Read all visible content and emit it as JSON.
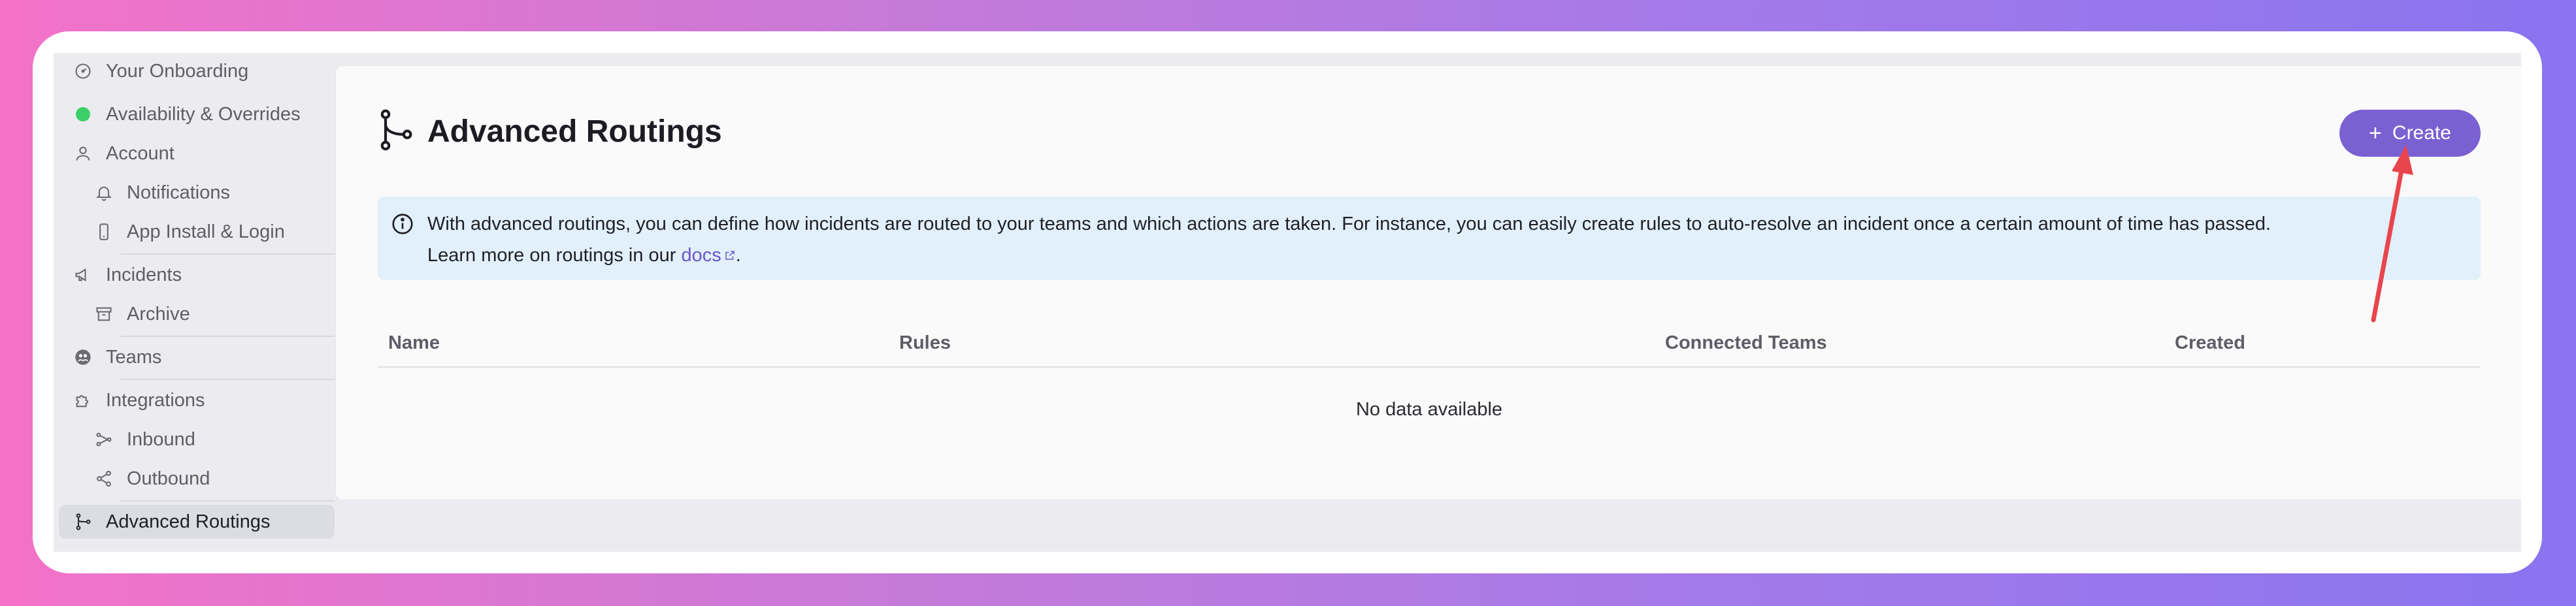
{
  "sidebar": {
    "items": [
      {
        "label": "Your Onboarding",
        "icon": "onboarding-gauge-icon"
      },
      {
        "label": "Availability & Overrides",
        "icon": "status-dot-icon",
        "status_color": "#3ccf6a"
      },
      {
        "label": "Account",
        "icon": "user-icon"
      },
      {
        "label": "Notifications",
        "icon": "bell-icon"
      },
      {
        "label": "App Install & Login",
        "icon": "smartphone-icon"
      },
      {
        "label": "Incidents",
        "icon": "megaphone-icon"
      },
      {
        "label": "Archive",
        "icon": "archive-icon"
      },
      {
        "label": "Teams",
        "icon": "teams-icon"
      },
      {
        "label": "Integrations",
        "icon": "puzzle-icon"
      },
      {
        "label": "Inbound",
        "icon": "inbound-icon"
      },
      {
        "label": "Outbound",
        "icon": "share-icon"
      },
      {
        "label": "Advanced Routings",
        "icon": "routing-icon",
        "active": true
      }
    ]
  },
  "header": {
    "title": "Advanced Routings",
    "create_label": "Create",
    "accent_color": "#7b60d2"
  },
  "info": {
    "line1": "With advanced routings, you can define how incidents are routed to your teams and which actions are taken. For instance, you can easily create rules to auto-resolve an incident once a certain amount of time has passed.",
    "line2_prefix": "Learn more on routings in our ",
    "link_label": "docs",
    "line2_suffix": "."
  },
  "table": {
    "columns": [
      "Name",
      "Rules",
      "Connected Teams",
      "Created"
    ],
    "empty_text": "No data available"
  },
  "annotation": {
    "arrow_color": "#e9454d"
  }
}
